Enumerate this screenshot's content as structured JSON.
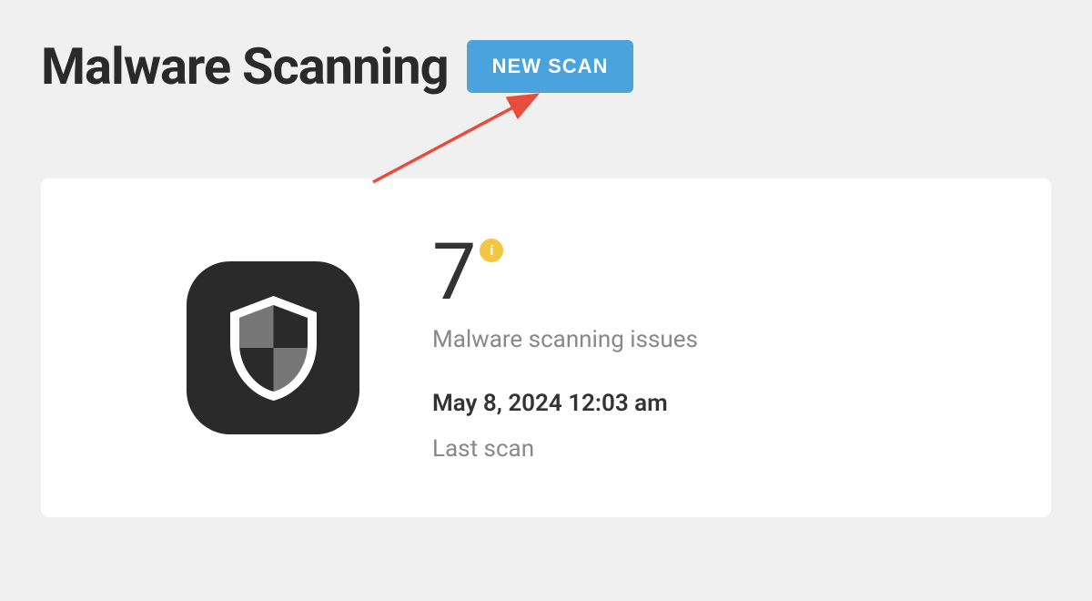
{
  "header": {
    "title": "Malware Scanning",
    "newScanButton": "NEW SCAN"
  },
  "card": {
    "issueCount": "7",
    "issuesLabel": "Malware scanning issues",
    "lastScanDate": "May 8, 2024 12:03 am",
    "lastScanLabel": "Last scan"
  }
}
